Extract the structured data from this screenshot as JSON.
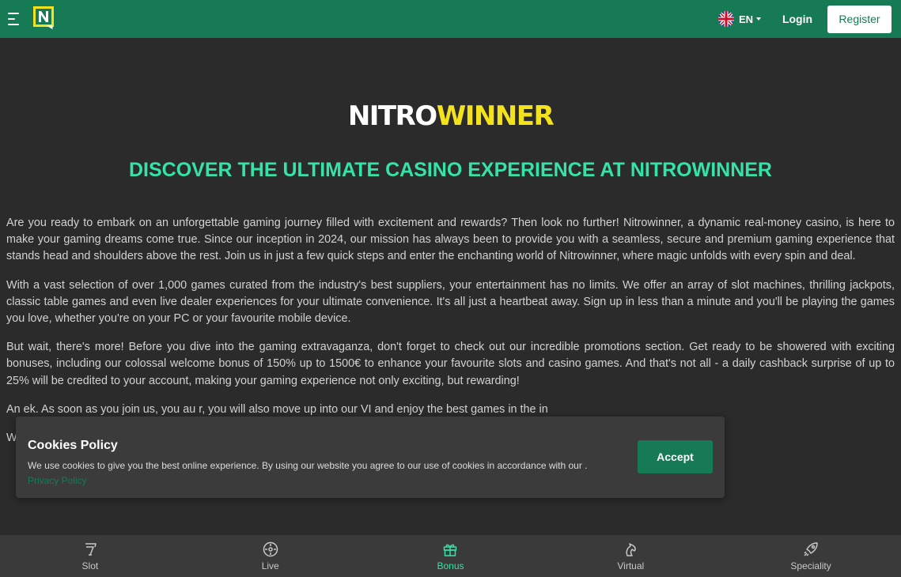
{
  "header": {
    "language": "EN",
    "login_label": "Login",
    "register_label": "Register"
  },
  "main": {
    "brand_part1": "NITRO",
    "brand_part2": "WINNER",
    "headline": "DISCOVER THE ULTIMATE CASINO EXPERIENCE AT NITROWINNER",
    "paragraphs": [
      "Are you ready to embark on an unforgettable gaming journey filled with excitement and rewards? Then look no further! Nitrowinner, a dynamic real-money casino, is here to make your gaming dreams come true. Since our inception in 2024, our mission has always been to provide you with a seamless, secure and premium gaming experience that stands head and shoulders above the rest. Join us in just a few quick steps and enter the enchanting world of Nitrowinner, where magic unfolds with every spin and deal.",
      "With a vast selection of over 1,000 games curated from the industry's best suppliers, your entertainment has no limits. We offer an array of slot machines, thrilling jackpots, classic table games and even live dealer experiences for your ultimate convenience. It's all just a heartbeat away. Sign up in less than a minute and you'll be playing the games you love, whether you're on your PC or your favourite mobile device.",
      "But wait, there's more! Before you dive into the gaming extravaganza, don't forget to check out our incredible promotions section. Get ready to be showered with exciting bonuses, including our colossal welcome bonus of 150% up to 1500€ to enhance your favourite slots and casino games. And that's not all - a daily cashback surprise of up to 25% will be credited to your account, making your gaming experience not only exciting, but rewarding!",
      "An                                                                                                                                                                              ek. As soon as you join us, you au                                                                                                                                                                              r, you will also move up into our VI                                                                                                                                                                              and enjoy the best games in the in",
      "Welcome to Nitrowinner - your ultimate destination for the most exceptional online casino games. Join us now and let the fun begin!"
    ]
  },
  "cookie": {
    "title": "Cookies Policy",
    "text": "We use cookies to give you the best online experience. By using our website you agree to our use of cookies in accordance with our .",
    "link_label": "Privacy Policy",
    "accept_label": "Accept"
  },
  "bottom_nav": {
    "items": [
      {
        "label": "Slot",
        "icon": "slot-icon"
      },
      {
        "label": "Live",
        "icon": "live-icon"
      },
      {
        "label": "Bonus",
        "icon": "gift-icon"
      },
      {
        "label": "Virtual",
        "icon": "horse-icon"
      },
      {
        "label": "Speciality",
        "icon": "rocket-icon"
      }
    ],
    "active": "Bonus"
  },
  "colors": {
    "brand_green": "#167b55",
    "accent_mint": "#35e3a6",
    "brand_yellow": "#f4e21c",
    "background": "#2b2b2b"
  }
}
